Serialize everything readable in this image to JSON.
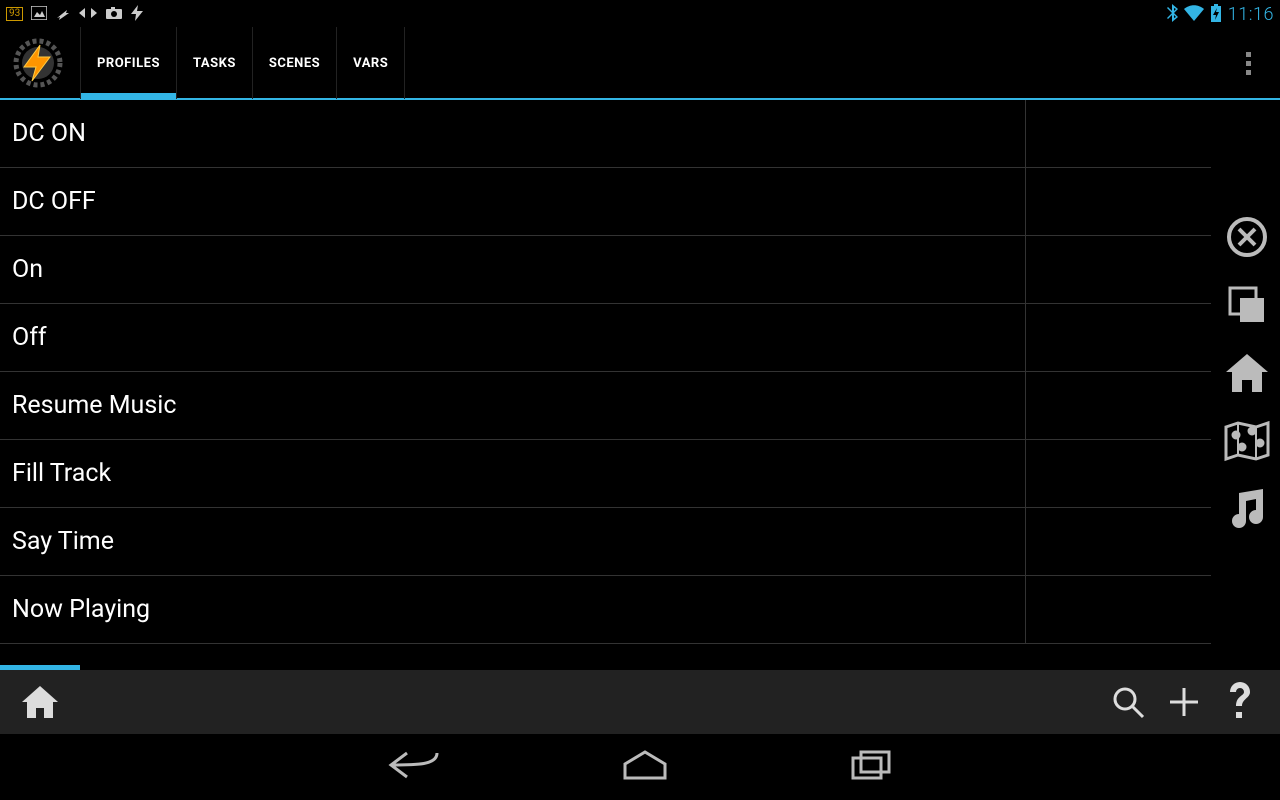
{
  "statusbar": {
    "battery_pct": "93",
    "time": "11:16"
  },
  "actionbar": {
    "tabs": [
      {
        "label": "PROFILES",
        "active": true
      },
      {
        "label": "TASKS",
        "active": false
      },
      {
        "label": "SCENES",
        "active": false
      },
      {
        "label": "VARS",
        "active": false
      }
    ]
  },
  "tasks": [
    {
      "name": "DC ON"
    },
    {
      "name": "DC OFF"
    },
    {
      "name": "On"
    },
    {
      "name": "Off"
    },
    {
      "name": "Resume Music"
    },
    {
      "name": "Fill Track"
    },
    {
      "name": "Say Time"
    },
    {
      "name": "Now Playing"
    }
  ],
  "side_icons": [
    "close-circle-icon",
    "copy-icon",
    "home-icon",
    "map-icon",
    "music-icon"
  ],
  "bottombar_icons": [
    "home-icon",
    "search-icon",
    "add-icon",
    "help-icon"
  ]
}
